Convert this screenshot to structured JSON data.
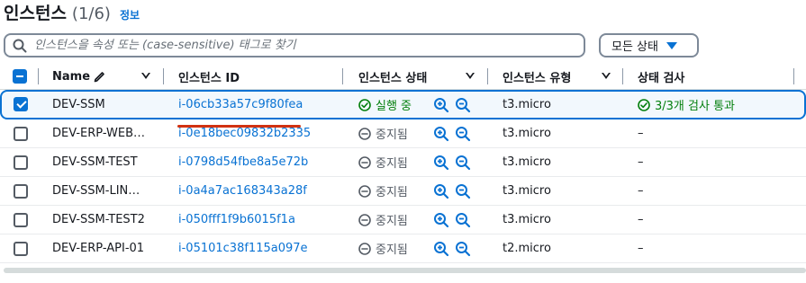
{
  "header": {
    "title": "인스턴스",
    "count": "(1/6)",
    "info": "정보"
  },
  "search": {
    "placeholder": "인스턴스을 속성 또는 (case-sensitive) 태그로 찾기"
  },
  "filter": {
    "label": "모든 상태"
  },
  "columns": {
    "name": "Name",
    "instance_id": "인스턴스 ID",
    "state": "인스턴스 상태",
    "type": "인스턴스 유형",
    "check": "상태 검사"
  },
  "rows": [
    {
      "name": "DEV-SSM",
      "id": "i-06cb33a57c9f80fea",
      "state": "실행 중",
      "type": "t3.micro",
      "check": "3/3개 검사 통과",
      "selected": true
    },
    {
      "name": "DEV-ERP-WEB…",
      "id": "i-0e18bec09832b2335",
      "state": "중지됨",
      "type": "t3.micro",
      "check": "–"
    },
    {
      "name": "DEV-SSM-TEST",
      "id": "i-0798d54fbe8a5e72b",
      "state": "중지됨",
      "type": "t3.micro",
      "check": "–"
    },
    {
      "name": "DEV-SSM-LIN…",
      "id": "i-0a4a7ac168343a28f",
      "state": "중지됨",
      "type": "t3.micro",
      "check": "–"
    },
    {
      "name": "DEV-SSM-TEST2",
      "id": "i-050fff1f9b6015f1a",
      "state": "중지됨",
      "type": "t3.micro",
      "check": "–"
    },
    {
      "name": "DEV-ERP-API-01",
      "id": "i-05101c38f115a097e",
      "state": "중지됨",
      "type": "t2.micro",
      "check": "–"
    }
  ],
  "colors": {
    "link": "#0972d3",
    "running": "#037f0c",
    "stopped": "#545b64",
    "annotation": "#d13212"
  },
  "icons": [
    "search-icon",
    "pencil-icon",
    "sort-icon",
    "check-circle-icon",
    "stop-circle-icon",
    "zoom-in-icon",
    "zoom-out-icon"
  ]
}
